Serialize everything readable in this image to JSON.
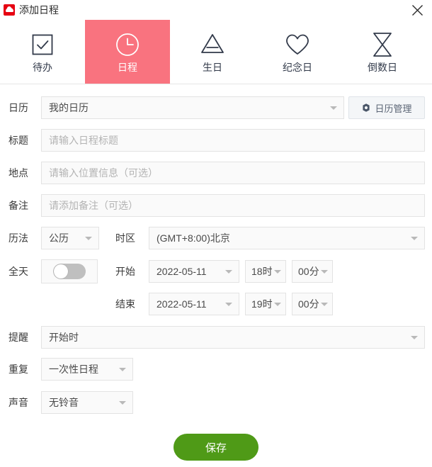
{
  "window": {
    "title": "添加日程",
    "app_icon": "cloud-app-icon",
    "close_icon": "close-icon"
  },
  "tabs": [
    {
      "label": "待办",
      "icon": "checkbox-icon",
      "active": false
    },
    {
      "label": "日程",
      "icon": "clock-icon",
      "active": true
    },
    {
      "label": "生日",
      "icon": "cake-icon",
      "active": false
    },
    {
      "label": "纪念日",
      "icon": "heart-icon",
      "active": false
    },
    {
      "label": "倒数日",
      "icon": "hourglass-icon",
      "active": false
    }
  ],
  "form": {
    "calendar": {
      "label": "日历",
      "value": "我的日历",
      "manage_button": "日历管理",
      "manage_icon": "gear-icon"
    },
    "title": {
      "label": "标题",
      "value": "",
      "placeholder": "请输入日程标题"
    },
    "location": {
      "label": "地点",
      "value": "",
      "placeholder": "请输入位置信息（可选）"
    },
    "note": {
      "label": "备注",
      "value": "",
      "placeholder": "请添加备注（可选）"
    },
    "calendar_system": {
      "label": "历法",
      "value": "公历"
    },
    "timezone": {
      "label": "时区",
      "value": "(GMT+8:00)北京"
    },
    "all_day": {
      "label": "全天",
      "value": "off"
    },
    "start": {
      "label": "开始",
      "date": "2022-05-11",
      "hour": "18时",
      "minute": "00分"
    },
    "end": {
      "label": "结束",
      "date": "2022-05-11",
      "hour": "19时",
      "minute": "00分"
    },
    "reminder": {
      "label": "提醒",
      "value": "开始时"
    },
    "repeat": {
      "label": "重复",
      "value": "一次性日程"
    },
    "sound": {
      "label": "声音",
      "value": "无铃音"
    },
    "save_button": "保存"
  },
  "colors": {
    "accent_pink": "#f9737f",
    "save_green": "#4f9a17",
    "app_red": "#e60012",
    "field_bg": "#fafafa",
    "field_border": "#e3e3e3"
  }
}
